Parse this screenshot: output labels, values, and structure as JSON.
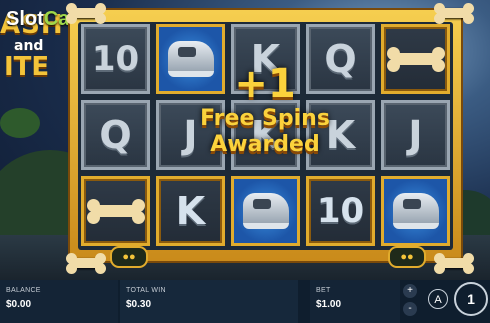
{
  "watermark": {
    "part1": "Slot",
    "part2": "Catalog"
  },
  "logo": {
    "line1": "ASH",
    "line2": "and",
    "line3": "ITE"
  },
  "reels": [
    [
      "10",
      "shoe",
      "K",
      "Q",
      "bone"
    ],
    [
      "Q",
      "J",
      "K",
      "K",
      "J"
    ],
    [
      "bone",
      "K",
      "shoe",
      "10",
      "shoe"
    ]
  ],
  "award": {
    "plus": "+1",
    "line1": "Free Spins",
    "line2": "Awarded"
  },
  "balance": {
    "label": "BALANCE",
    "value": "$0.00"
  },
  "total_win": {
    "label": "TOTAL WIN",
    "value": "$0.30"
  },
  "bet": {
    "label": "BET",
    "value": "$1.00",
    "up": "+",
    "down": "-"
  },
  "autoplay_label": "A",
  "spin_label": "1",
  "colors": {
    "frame_gold": "#e1ac2d",
    "award_text": "#fbd23c",
    "bar": "#0f1e2e"
  }
}
